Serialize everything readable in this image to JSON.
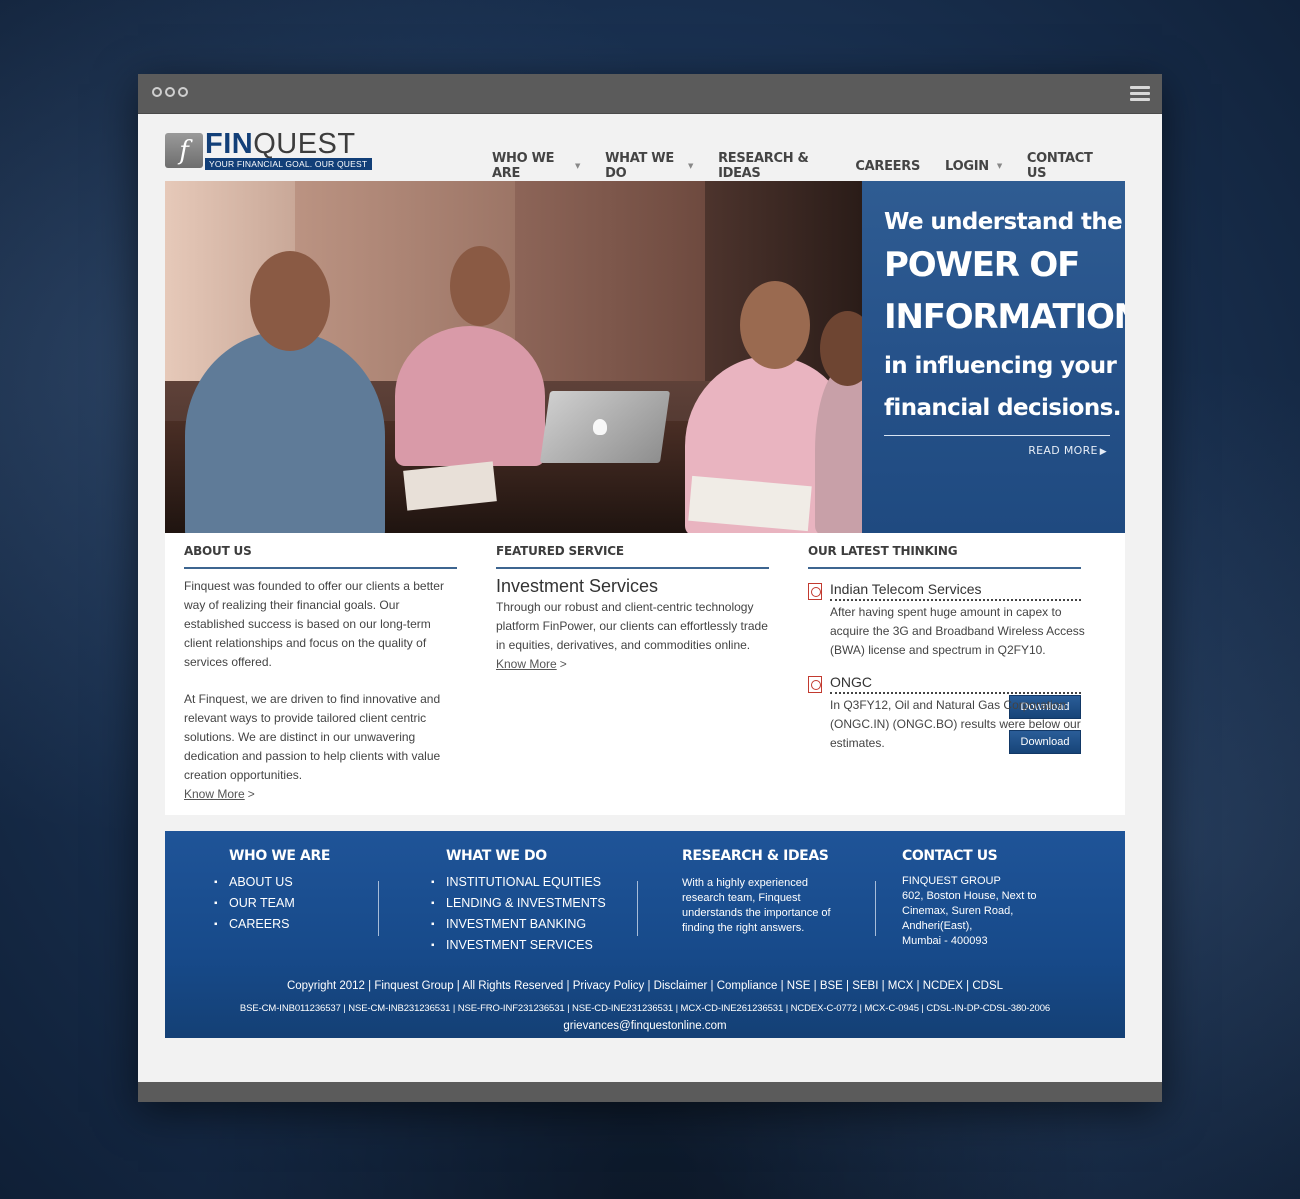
{
  "brand": {
    "name_part1": "FIN",
    "name_part2": "QUEST",
    "tagline": "YOUR FINANCIAL GOAL. OUR QUEST",
    "mark": "f"
  },
  "nav": [
    {
      "label": "WHO WE ARE",
      "dropdown": true
    },
    {
      "label": "WHAT WE DO",
      "dropdown": true
    },
    {
      "label": "RESEARCH & IDEAS",
      "dropdown": false
    },
    {
      "label": "CAREERS",
      "dropdown": false
    },
    {
      "label": "LOGIN",
      "dropdown": true
    },
    {
      "label": "CONTACT US",
      "dropdown": false
    }
  ],
  "hero": {
    "line1": "We understand the",
    "line2": "POWER OF",
    "line3": "INFORMATION",
    "line4": "in influencing your",
    "line5": "financial decisions.",
    "read_more": "READ MORE"
  },
  "about": {
    "title": "ABOUT US",
    "p1": "Finquest was founded to offer our clients a better way of realizing their financial goals. Our established success is based on our long-term client relationships and focus on the quality of services offered.",
    "p2": "At Finquest, we are driven to find innovative and relevant ways to provide tailored client centric solutions. We are distinct in our unwavering dedication and passion to help clients with value creation opportunities.",
    "link": "Know More"
  },
  "featured": {
    "title": "FEATURED SERVICE",
    "service_title": "Investment Services",
    "text": "Through our robust and client-centric technology platform FinPower, our clients can effortlessly trade in equities, derivatives, and commodities online.",
    "link": "Know More"
  },
  "thinking": {
    "title": "OUR LATEST THINKING",
    "items": [
      {
        "title": "Indian Telecom Services",
        "desc": "After having spent huge amount in capex to acquire the 3G and Broadband Wireless Access (BWA) license and spectrum in Q2FY10.",
        "button": "Download"
      },
      {
        "title": "ONGC",
        "desc": "In Q3FY12, Oil and Natural Gas Corporation (ONGC.IN) (ONGC.BO) results were below our estimates.",
        "button": "Download"
      }
    ]
  },
  "footer": {
    "who": {
      "title": "WHO WE ARE",
      "items": [
        "ABOUT US",
        "OUR TEAM",
        "CAREERS"
      ]
    },
    "what": {
      "title": "WHAT WE DO",
      "items": [
        "INSTITUTIONAL EQUITIES",
        "LENDING & INVESTMENTS",
        "INVESTMENT BANKING",
        "INVESTMENT SERVICES"
      ]
    },
    "research": {
      "title": "RESEARCH & IDEAS",
      "text": "With a highly experienced research team, Finquest understands the importance of finding the right answers."
    },
    "contact": {
      "title": "CONTACT US",
      "address": "FINQUEST GROUP\n602, Boston House, Next to Cinemax, Suren Road, Andheri(East),\nMumbai - 400093"
    },
    "copyright": "Copyright 2012 | Finquest Group | All Rights Reserved | Privacy Policy | Disclaimer | Compliance | NSE | BSE | SEBI | MCX | NCDEX | CDSL",
    "registrations": "BSE-CM-INB011236537 | NSE-CM-INB231236531 | NSE-FRO-INF231236531 | NSE-CD-INE231236531 | MCX-CD-INE261236531 | NCDEX-C-0772 | MCX-C-0945 | CDSL-IN-DP-CDSL-380-2006",
    "email": "grievances@finquestonline.com"
  },
  "colors": {
    "brand_blue": "#123f78",
    "hero_panel": "#26528a",
    "footer_blue": "#174a8a",
    "button_blue": "#1f5190"
  }
}
